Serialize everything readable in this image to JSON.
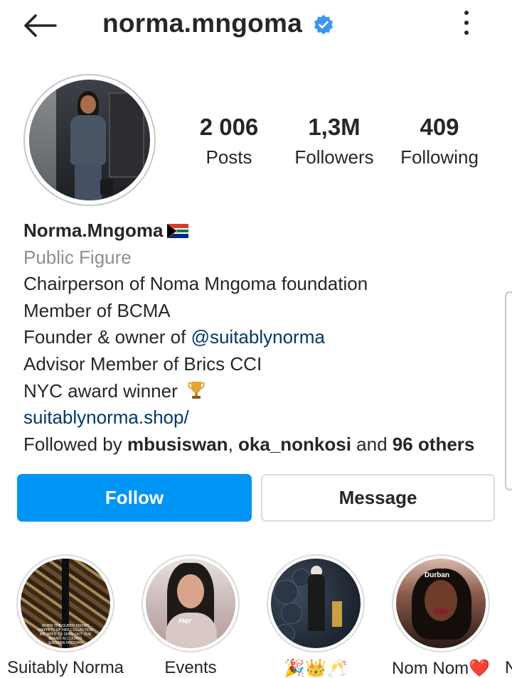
{
  "header": {
    "username": "norma.mngoma",
    "verified": true,
    "back_icon": "arrow-left-icon",
    "more_icon": "more-vertical-icon"
  },
  "stats": {
    "posts": {
      "value": "2 006",
      "label": "Posts"
    },
    "followers": {
      "value": "1,3M",
      "label": "Followers"
    },
    "following": {
      "value": "409",
      "label": "Following"
    }
  },
  "bio": {
    "display_name": "Norma.Mngoma",
    "category": "Public Figure",
    "line1": "Chairperson of Noma Mngoma foundation",
    "line2": "Member of BCMA",
    "line3_prefix": "Founder & owner of ",
    "line3_mention": "@suitablynorma",
    "line4": "Advisor Member of Brics CCI",
    "line5": "NYC award winner",
    "website": "suitablynorma.shop/",
    "followed_by_prefix": "Followed by ",
    "followed_by_user1": "mbusiswan",
    "followed_by_sep": ", ",
    "followed_by_user2": "oka_nonkosi",
    "followed_by_and": " and ",
    "followed_by_others": "96 others"
  },
  "actions": {
    "follow_label": "Follow",
    "message_label": "Message"
  },
  "highlights": [
    {
      "label": "Suitably Norma",
      "cover_caption": "WHEN THE QUEEN SHOWS SNIPPETS OF HER COLLECTION WE NEED TO SEND OUT OUR BRAND ACCOUNTS @NORMA.MNGOMA"
    },
    {
      "label": "Events",
      "cover_caption": "Her"
    },
    {
      "label": "🎉👑🥂"
    },
    {
      "label": "Nom Nom❤️",
      "cover_caption": "Durban"
    },
    {
      "label": "N"
    }
  ],
  "colors": {
    "primary_blue": "#0095f6",
    "verified_blue": "#3897f0",
    "link_color": "#00376b",
    "secondary_text": "#8e8e8e",
    "text": "#262626"
  }
}
